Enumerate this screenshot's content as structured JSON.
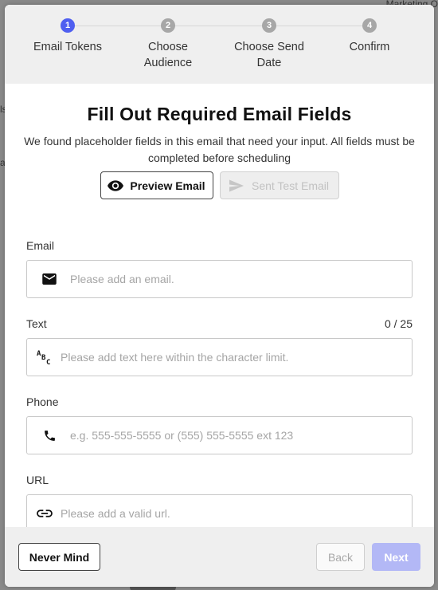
{
  "background": {
    "top_right_text": "Marketing O",
    "left_snippet_1": "ls",
    "left_snippet_2": "ar"
  },
  "stepper": {
    "steps": [
      {
        "number": "1",
        "label": "Email Tokens",
        "active": true
      },
      {
        "number": "2",
        "label": "Choose Audience",
        "active": false
      },
      {
        "number": "3",
        "label": "Choose Send Date",
        "active": false
      },
      {
        "number": "4",
        "label": "Confirm",
        "active": false
      }
    ]
  },
  "header": {
    "title": "Fill Out Required Email Fields",
    "subtitle": "We found placeholder fields in this email that need your input. All fields must be completed before scheduling"
  },
  "actions": {
    "preview_label": "Preview Email",
    "test_label": "Sent Test Email"
  },
  "form": {
    "email": {
      "label": "Email",
      "placeholder": "Please add an email.",
      "icon": "mail-icon"
    },
    "text": {
      "label": "Text",
      "counter": "0 / 25",
      "placeholder": "Please add text here within the character limit.",
      "icon": "spellcheck-icon"
    },
    "phone": {
      "label": "Phone",
      "placeholder": "e.g. 555-555-5555 or (555) 555-5555 ext 123",
      "icon": "phone-icon"
    },
    "url": {
      "label": "URL",
      "placeholder": "Please add a valid url.",
      "icon": "link-icon"
    }
  },
  "footer": {
    "never_mind_label": "Never Mind",
    "back_label": "Back",
    "next_label": "Next"
  },
  "colors": {
    "accent": "#4f5ff0",
    "next_disabled": "#b3b8f6"
  }
}
